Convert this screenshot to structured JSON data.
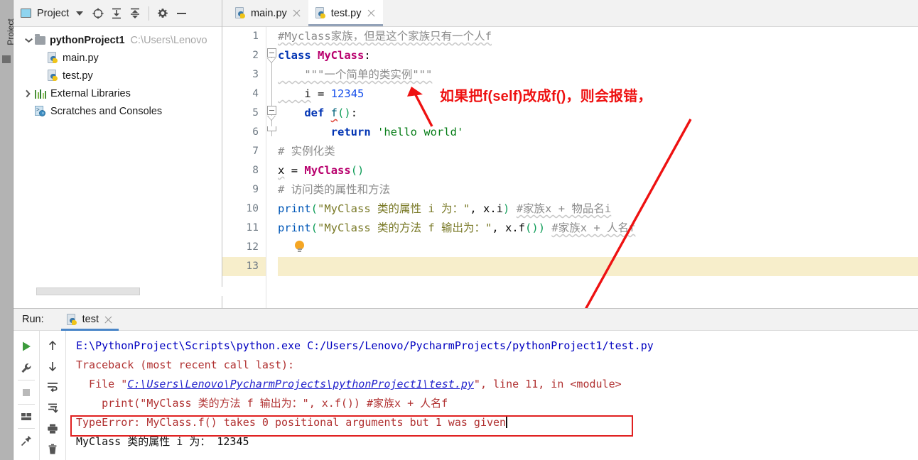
{
  "window": {
    "left_stripe_label": "Project"
  },
  "project_panel": {
    "title": "Project",
    "icons": [
      "project-view-icon",
      "chevron-down-icon",
      "locate-icon",
      "expand-all-icon",
      "collapse-all-icon",
      "gear-icon",
      "minimize-icon"
    ],
    "tree": [
      {
        "label": "pythonProject1",
        "path": "C:\\Users\\Lenovo",
        "icon": "folder-icon",
        "expanded": true,
        "bold": true,
        "indent": 0
      },
      {
        "label": "main.py",
        "path": "",
        "icon": "python-file-icon",
        "expanded": null,
        "bold": false,
        "indent": 1
      },
      {
        "label": "test.py",
        "path": "",
        "icon": "python-file-icon",
        "expanded": null,
        "bold": false,
        "indent": 1
      },
      {
        "label": "External Libraries",
        "path": "",
        "icon": "libraries-icon",
        "expanded": false,
        "bold": false,
        "indent": 0
      },
      {
        "label": "Scratches and Consoles",
        "path": "",
        "icon": "scratches-icon",
        "expanded": null,
        "bold": false,
        "indent": 0
      }
    ]
  },
  "editor": {
    "tabs": [
      {
        "label": "main.py",
        "icon": "python-file-icon",
        "active": false
      },
      {
        "label": "test.py",
        "icon": "python-file-icon",
        "active": true
      }
    ],
    "current_line": 13,
    "line_numbers": [
      "1",
      "2",
      "3",
      "4",
      "5",
      "6",
      "7",
      "8",
      "9",
      "10",
      "11",
      "12",
      "13"
    ],
    "code_lines": [
      {
        "n": 1,
        "text": "#Myclass家族，但是这个家族只有一个人f"
      },
      {
        "n": 2,
        "text": "class MyClass:"
      },
      {
        "n": 3,
        "text": "    \"\"\"一个简单的类实例\"\"\""
      },
      {
        "n": 4,
        "text": "    i = 12345"
      },
      {
        "n": 5,
        "text": "    def f():"
      },
      {
        "n": 6,
        "text": "        return 'hello world'"
      },
      {
        "n": 7,
        "text": "# 实例化类"
      },
      {
        "n": 8,
        "text": "x = MyClass()"
      },
      {
        "n": 9,
        "text": "# 访问类的属性和方法"
      },
      {
        "n": 10,
        "text": "print(\"MyClass 类的属性 i 为：\", x.i) #家族x + 物品名i"
      },
      {
        "n": 11,
        "text": "print(\"MyClass 类的方法 f 输出为：\", x.f()) #家族x + 人名f"
      },
      {
        "n": 12,
        "text": ""
      },
      {
        "n": 13,
        "text": ""
      }
    ]
  },
  "annotation": {
    "text": "如果把f(self)改成f()，则会报错，",
    "color": "#ee1111"
  },
  "run_panel": {
    "label": "Run:",
    "tab_label": "test",
    "tab_icon": "python-file-icon",
    "toolbar_left": [
      "run-icon",
      "wrench-icon",
      "stop-icon",
      "layout-icon",
      "pin-icon"
    ],
    "toolbar_right": [
      "up-arrow-icon",
      "down-arrow-icon",
      "soft-wrap-icon",
      "scroll-to-end-icon",
      "print-icon",
      "trash-icon"
    ],
    "console_lines": [
      {
        "kind": "cmd",
        "text": "E:\\PythonProject\\Scripts\\python.exe C:/Users/Lenovo/PycharmProjects/pythonProject1/test.py"
      },
      {
        "kind": "err",
        "text": "Traceback (most recent call last):"
      },
      {
        "kind": "file_line",
        "prefix": "  File \"",
        "link": "C:\\Users\\Lenovo\\PycharmProjects\\pythonProject1\\test.py",
        "suffix": "\", line 11, in <module>"
      },
      {
        "kind": "err",
        "text": "    print(\"MyClass 类的方法 f 输出为：\", x.f()) #家族x + 人名f"
      },
      {
        "kind": "err_boxed",
        "text": "TypeError: MyClass.f() takes 0 positional arguments but 1 was given"
      },
      {
        "kind": "out",
        "text": "MyClass 类的属性 i 为： 12345"
      }
    ]
  },
  "colors": {
    "keyword": "#0033b3",
    "class_name": "#b8006d",
    "number": "#1750eb",
    "string": "#067d17",
    "comment": "#8c8c8c",
    "current_line_bg": "#f7eecb",
    "annotation_red": "#ee1111",
    "error_box_border": "#e02020",
    "console_error": "#b03030",
    "console_cmd": "#0000c0"
  }
}
